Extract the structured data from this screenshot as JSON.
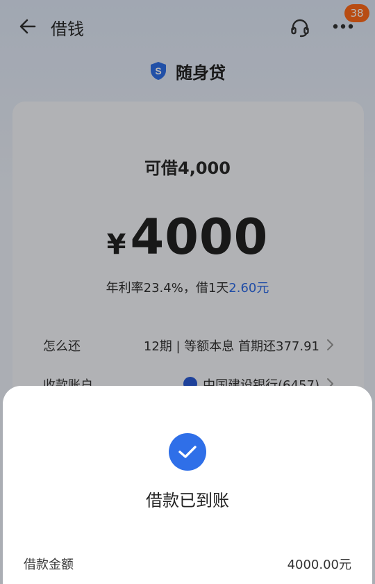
{
  "header": {
    "title": "借钱",
    "badge_count": "38"
  },
  "product": {
    "name": "随身贷",
    "logo_letter": "S"
  },
  "loan": {
    "limit_text": "可借4,000",
    "currency_symbol": "¥",
    "amount": "4000",
    "rate_prefix": "年利率23.4%，借1天",
    "rate_highlight": "2.60元"
  },
  "rows": {
    "repay_label": "怎么还",
    "repay_value": "12期 | 等额本息 首期还377.91",
    "account_label": "收款账户",
    "account_value": "中国建设银行(6457)"
  },
  "sheet": {
    "title": "借款已到账",
    "detail_label": "借款金额",
    "detail_value": "4000.00元"
  },
  "colors": {
    "accent": "#2f6fe8",
    "badge": "#ff6a1a"
  }
}
